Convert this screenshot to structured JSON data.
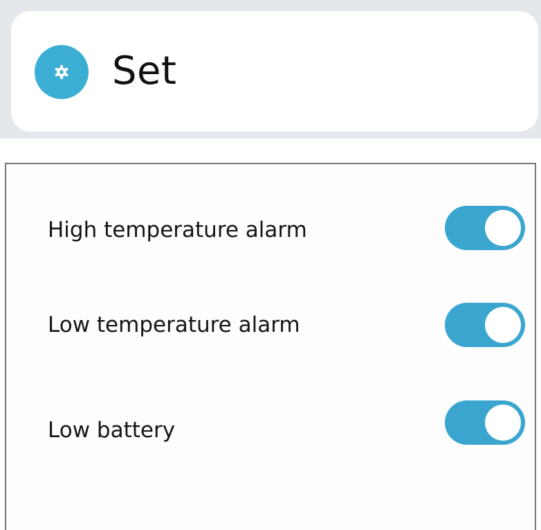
{
  "header": {
    "title": "Set",
    "icon": "gear-icon",
    "accent_color": "#3caed3"
  },
  "settings": {
    "items": [
      {
        "label": "High temperature alarm",
        "enabled": true
      },
      {
        "label": "Low temperature alarm",
        "enabled": true
      },
      {
        "label": "Low battery",
        "enabled": true
      }
    ],
    "toggle_color": "#3aa6cf"
  }
}
